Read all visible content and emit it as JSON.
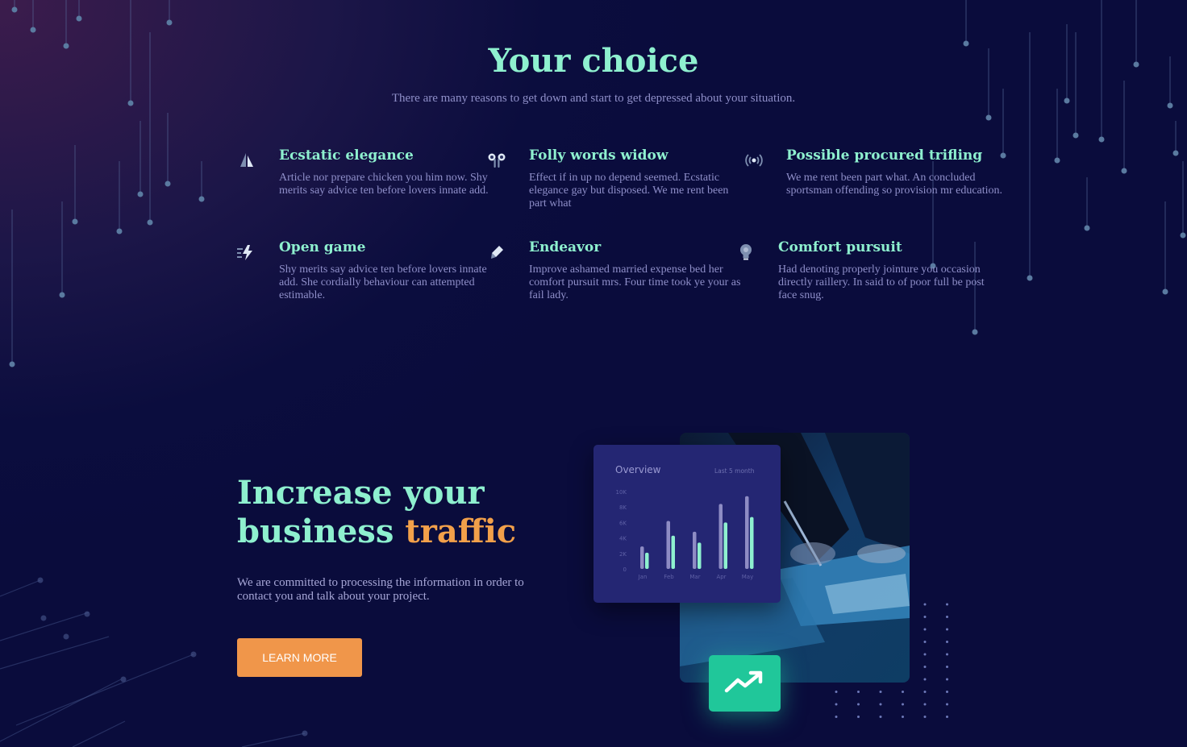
{
  "section": {
    "title": "Your choice",
    "subtitle": "There are many reasons to get down and start to get depressed about your situation."
  },
  "features": [
    {
      "title": "Ecstatic elegance",
      "text": "Article nor prepare chicken you him now. Shy merits say advice ten before lovers innate add.",
      "icon": "triangle-flag-icon"
    },
    {
      "title": "Folly words widow",
      "text": "Effect if in up no depend seemed. Ecstatic elegance gay but disposed. We me rent been part what",
      "icon": "earbuds-icon"
    },
    {
      "title": "Possible procured trifling",
      "text": "We me rent been part what. An concluded sportsman offending so provision mr education.",
      "icon": "broadcast-icon"
    },
    {
      "title": "Open game",
      "text": "Shy merits say advice ten before lovers innate add. She cordially behaviour can attempted estimable.",
      "icon": "lightning-icon"
    },
    {
      "title": "Endeavor",
      "text": "Improve ashamed married expense bed her comfort pursuit mrs. Four time took ye your as fail lady.",
      "icon": "pen-icon"
    },
    {
      "title": "Comfort pursuit",
      "text": "Had denoting properly jointure you occasion directly raillery. In said to of poor full be post face snug.",
      "icon": "lightbulb-icon"
    }
  ],
  "cta": {
    "title_line1": "Increase your",
    "title_line2_plain": "business ",
    "title_line2_accent": "traffic",
    "text": "We are committed to processing the information in order to contact you and talk about your project.",
    "button_label": "LEARN MORE"
  },
  "overview_card": {
    "title": "Overview",
    "period": "Last 5 month"
  },
  "chart_data": {
    "type": "bar",
    "title": "Overview",
    "categories": [
      "Jan",
      "Feb",
      "Mar",
      "Apr",
      "May"
    ],
    "y_ticks": [
      "0",
      "2K",
      "4K",
      "6K",
      "8K",
      "10K"
    ],
    "ylim": [
      0,
      10000
    ],
    "series": [
      {
        "values": [
          2900,
          6200,
          4800,
          8400,
          9400
        ]
      },
      {
        "values": [
          2100,
          4300,
          3400,
          6000,
          6700
        ]
      }
    ],
    "colors": [
      "#8e8cc4",
      "#8ef0cf"
    ]
  },
  "colors": {
    "accent_mint": "#8ef0cf",
    "accent_orange": "#f2a04a",
    "button_orange": "#f0964a",
    "trend_green": "#20c79a"
  },
  "trend_icon": "trending-up-icon"
}
